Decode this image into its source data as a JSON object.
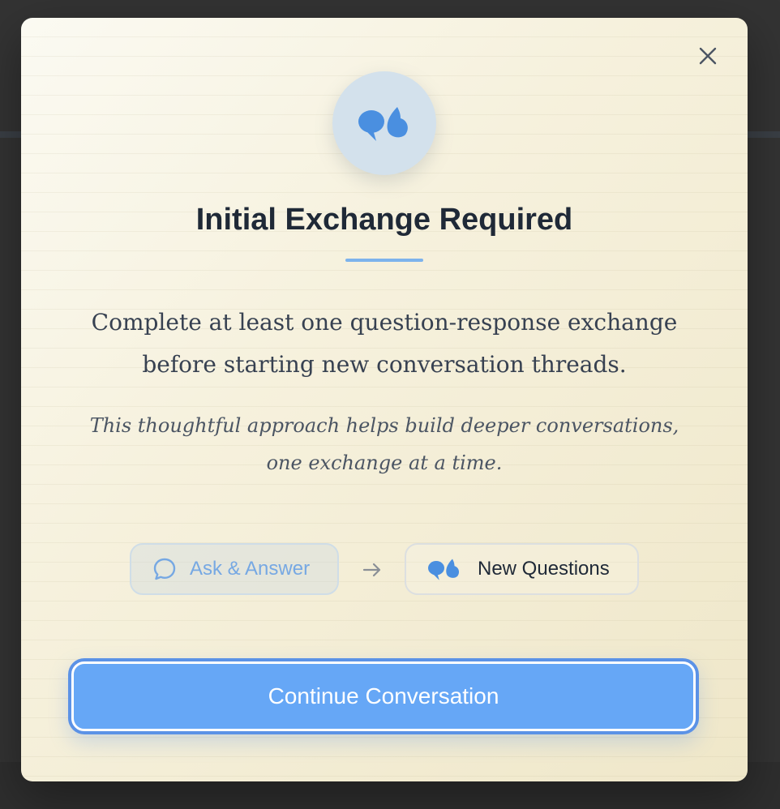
{
  "dialog": {
    "title": "Initial Exchange Required",
    "body": "Complete at least one question-response exchange before starting new conversation threads.",
    "note": "This thoughtful approach helps build deeper conversations, one exchange at a time.",
    "close_icon": "close-icon",
    "hero_icon": "quote-bubbles-icon"
  },
  "flow": {
    "step_from": {
      "label": "Ask & Answer",
      "icon": "chat-bubble-icon"
    },
    "arrow_icon": "arrow-right-icon",
    "step_to": {
      "label": "New Questions",
      "icon": "quote-bubbles-icon"
    }
  },
  "actions": {
    "primary_label": "Continue Conversation"
  },
  "colors": {
    "accent": "#66a7f6",
    "accent_border": "#5b92e6",
    "title": "#1f2937",
    "icon_blue": "#4a8fe0"
  }
}
